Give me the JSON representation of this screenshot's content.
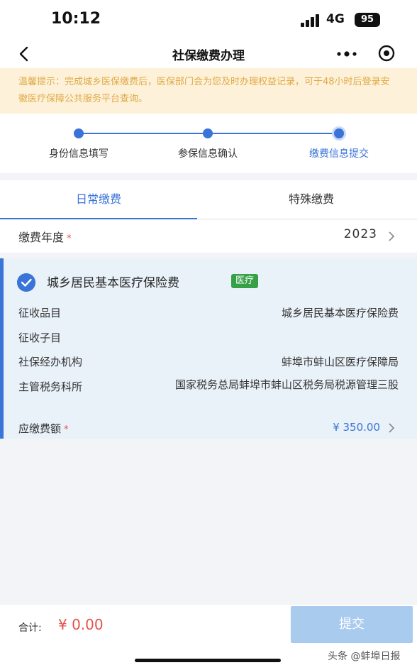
{
  "status_bar": {
    "time": "10:12",
    "network": "4G",
    "battery": "95"
  },
  "nav": {
    "title": "社保缴费办理"
  },
  "notice": {
    "text": "温馨提示：完成城乡医保缴费后，医保部门会为您及时办理权益记录，可于48小时后登录安徽医疗保障公共服务平台查询。"
  },
  "steps": [
    {
      "label": "身份信息填写",
      "active": false
    },
    {
      "label": "参保信息确认",
      "active": false
    },
    {
      "label": "缴费信息提交",
      "active": true
    }
  ],
  "tabs": [
    {
      "label": "日常缴费",
      "active": true
    },
    {
      "label": "特殊缴费",
      "active": false
    }
  ],
  "year_row": {
    "label": "缴费年度",
    "required_mark": "*",
    "value": "2023"
  },
  "card": {
    "title": "城乡居民基本医疗保险费",
    "badge": "医疗",
    "rows": [
      {
        "label": "征收品目",
        "value": "城乡居民基本医疗保险费"
      },
      {
        "label": "征收子目",
        "value": ""
      },
      {
        "label": "社保经办机构",
        "value": "蚌埠市蚌山区医疗保障局"
      },
      {
        "label": "主管税务科所",
        "value": "国家税务总局蚌埠市蚌山区税务局税源管理三股"
      }
    ],
    "amount_label": "应缴费额",
    "amount_required_mark": "*",
    "amount_value": "¥  350.00"
  },
  "bottom": {
    "total_label": "合计:",
    "total_value": "¥ 0.00",
    "submit_label": "提交",
    "watermark": "头条 @蚌埠日报"
  },
  "colors": {
    "accent": "#3a74d8",
    "notice_bg": "#fdf2d9",
    "notice_text": "#e0a845",
    "badge": "#36a046",
    "price": "#e2534a",
    "submit_disabled": "#a9cbee"
  }
}
